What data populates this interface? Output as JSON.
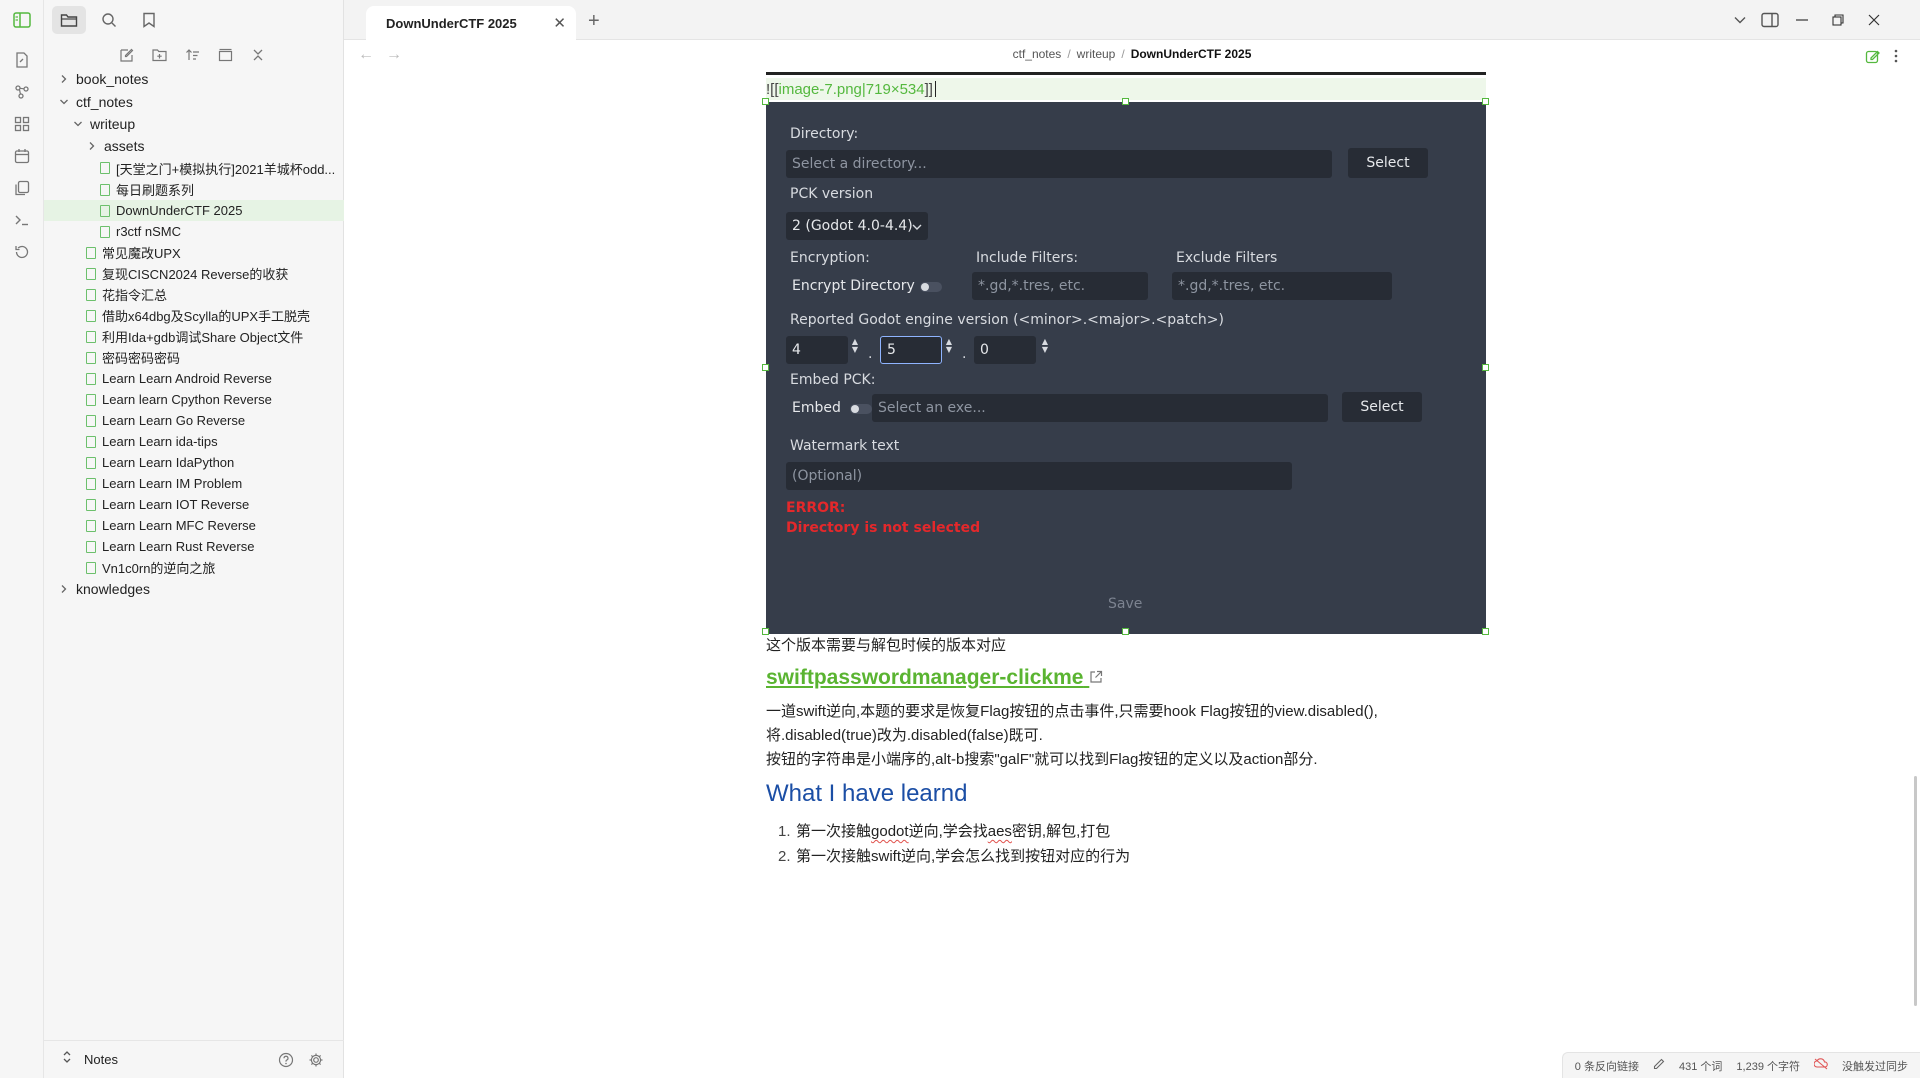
{
  "tab": {
    "title": "DownUnderCTF 2025"
  },
  "breadcrumb": {
    "part1": "ctf_notes",
    "part2": "writeup",
    "current": "DownUnderCTF 2025"
  },
  "tree": [
    {
      "label": "book_notes",
      "type": "folder",
      "level": 0,
      "open": false
    },
    {
      "label": "ctf_notes",
      "type": "folder",
      "level": 0,
      "open": true
    },
    {
      "label": "writeup",
      "type": "folder",
      "level": 1,
      "open": true
    },
    {
      "label": "assets",
      "type": "folder",
      "level": 2,
      "open": false
    },
    {
      "label": "[天堂之门+模拟执行]2021羊城杯odd...",
      "type": "file",
      "level": 2
    },
    {
      "label": "每日刷题系列",
      "type": "file",
      "level": 2
    },
    {
      "label": "DownUnderCTF 2025",
      "type": "file",
      "level": 2,
      "selected": true
    },
    {
      "label": "r3ctf nSMC",
      "type": "file",
      "level": 2
    },
    {
      "label": "常见魔改UPX",
      "type": "file",
      "level": 1
    },
    {
      "label": "复现CISCN2024 Reverse的收获",
      "type": "file",
      "level": 1
    },
    {
      "label": "花指令汇总",
      "type": "file",
      "level": 1
    },
    {
      "label": "借助x64dbg及Scylla的UPX手工脱壳",
      "type": "file",
      "level": 1
    },
    {
      "label": "利用Ida+gdb调试Share Object文件",
      "type": "file",
      "level": 1
    },
    {
      "label": "密码密码密码",
      "type": "file",
      "level": 1
    },
    {
      "label": "Learn Learn Android Reverse",
      "type": "file",
      "level": 1
    },
    {
      "label": "Learn learn Cpython Reverse",
      "type": "file",
      "level": 1
    },
    {
      "label": "Learn Learn Go Reverse",
      "type": "file",
      "level": 1
    },
    {
      "label": "Learn Learn ida-tips",
      "type": "file",
      "level": 1
    },
    {
      "label": "Learn Learn IdaPython",
      "type": "file",
      "level": 1
    },
    {
      "label": "Learn Learn IM Problem",
      "type": "file",
      "level": 1
    },
    {
      "label": "Learn Learn IOT Reverse",
      "type": "file",
      "level": 1
    },
    {
      "label": "Learn Learn MFC Reverse",
      "type": "file",
      "level": 1
    },
    {
      "label": "Learn Learn Rust Reverse",
      "type": "file",
      "level": 1
    },
    {
      "label": "Vn1c0rn的逆向之旅",
      "type": "file",
      "level": 1
    },
    {
      "label": "knowledges",
      "type": "folder",
      "level": 0,
      "open": false
    }
  ],
  "vault": {
    "name": "Notes"
  },
  "embed": {
    "prefix": "![[",
    "name": "image-7.png|719×534",
    "suffix": "]]"
  },
  "godot": {
    "directory_label": "Directory:",
    "directory_placeholder": "Select a directory...",
    "select": "Select",
    "pck_label": "PCK version",
    "pck_value": "2 (Godot 4.0-4.4)",
    "encryption_label": "Encryption:",
    "encrypt_directory": "Encrypt Directory",
    "include_label": "Include Filters:",
    "include_placeholder": "*.gd,*.tres, etc.",
    "exclude_label": "Exclude Filters",
    "exclude_placeholder": "*.gd,*.tres, etc.",
    "version_label": "Reported Godot engine version (<minor>.<major>.<patch>)",
    "v_major": "4",
    "v_minor": "5",
    "v_patch": "0",
    "dot": ".",
    "embed_label": "Embed PCK:",
    "embed": "Embed",
    "exe_placeholder": "Select an exe...",
    "select2": "Select",
    "watermark_label": "Watermark text",
    "watermark_placeholder": "(Optional)",
    "error_title": "ERROR:",
    "error_msg": "Directory is not selected",
    "save": "Save"
  },
  "content": {
    "p1": "这个版本需要与解包时候的版本对应",
    "h3": "swiftpasswordmanager-clickme",
    "p2": "一道swift逆向,本题的要求是恢复Flag按钮的点击事件,只需要hook Flag按钮的view.disabled(),",
    "p3": "将.disabled(true)改为.disabled(false)既可.",
    "p4": "按钮的字符串是小端序的,alt-b搜索\"galF\"就可以找到Flag按钮的定义以及action部分.",
    "h2": "What I have learnd",
    "li1_num": "1.",
    "li1_a": "第一次接触",
    "li1_b": "godot",
    "li1_c": "逆向,学会找",
    "li1_d": "aes",
    "li1_e": "密钥,解包,打包",
    "li2_num": "2.",
    "li2": "第一次接触swift逆向,学会怎么找到按钮对应的行为"
  },
  "status": {
    "backlinks": "0 条反向链接",
    "words": "431 个词",
    "chars": "1,239 个字符",
    "sync": "没触发过同步"
  }
}
